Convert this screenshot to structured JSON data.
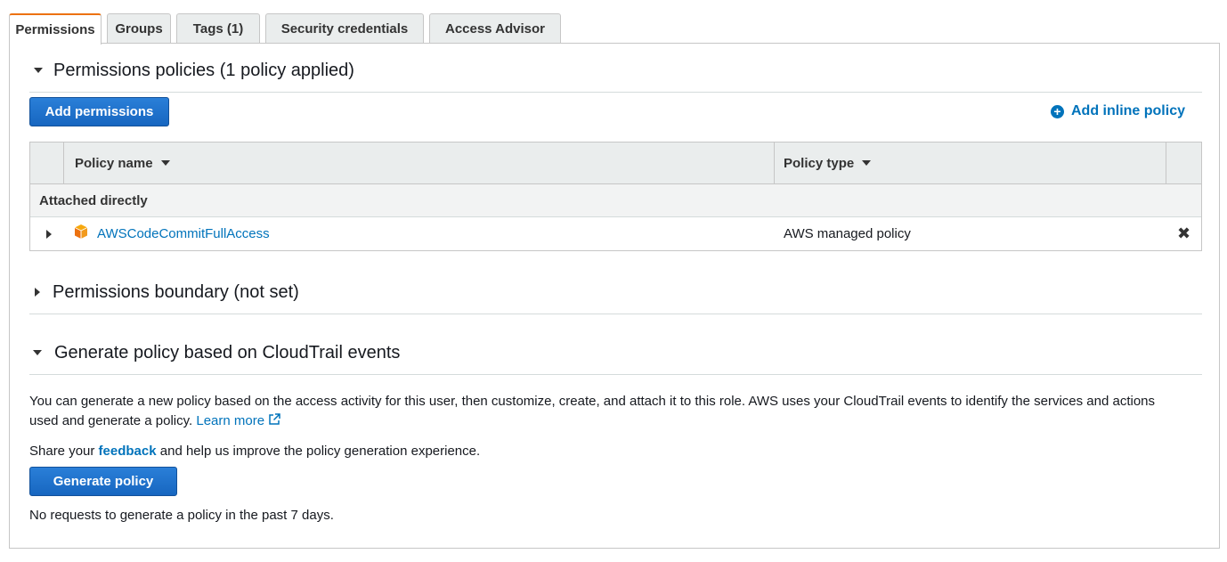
{
  "tabs": [
    {
      "label": "Permissions",
      "active": true
    },
    {
      "label": "Groups",
      "active": false
    },
    {
      "label": "Tags (1)",
      "active": false
    },
    {
      "label": "Security credentials",
      "active": false
    },
    {
      "label": "Access Advisor",
      "active": false
    }
  ],
  "permissions_policies": {
    "title": "Permissions policies (1 policy applied)",
    "add_permissions_label": "Add permissions",
    "add_inline_policy_label": "Add inline policy",
    "columns": {
      "policy_name": "Policy name",
      "policy_type": "Policy type"
    },
    "group_label": "Attached directly",
    "rows": [
      {
        "name": "AWSCodeCommitFullAccess",
        "type": "AWS managed policy"
      }
    ]
  },
  "permissions_boundary": {
    "title": "Permissions boundary (not set)"
  },
  "generate_policy": {
    "title": "Generate policy based on CloudTrail events",
    "description_line1": "You can generate a new policy based on the access activity for this user, then customize, create, and attach it to this role. AWS uses your CloudTrail events to identify the services and actions",
    "description_line2": "used and generate a policy.",
    "learn_more_label": "Learn more",
    "feedback_prefix": "Share your",
    "feedback_link": "feedback",
    "feedback_suffix": "and help us improve the policy generation experience.",
    "button_label": "Generate policy",
    "status_text": "No requests to generate a policy in the past 7 days."
  },
  "colors": {
    "accent_tab": "#ec7211",
    "link": "#0073bb",
    "primary_button": "#1766c0"
  }
}
